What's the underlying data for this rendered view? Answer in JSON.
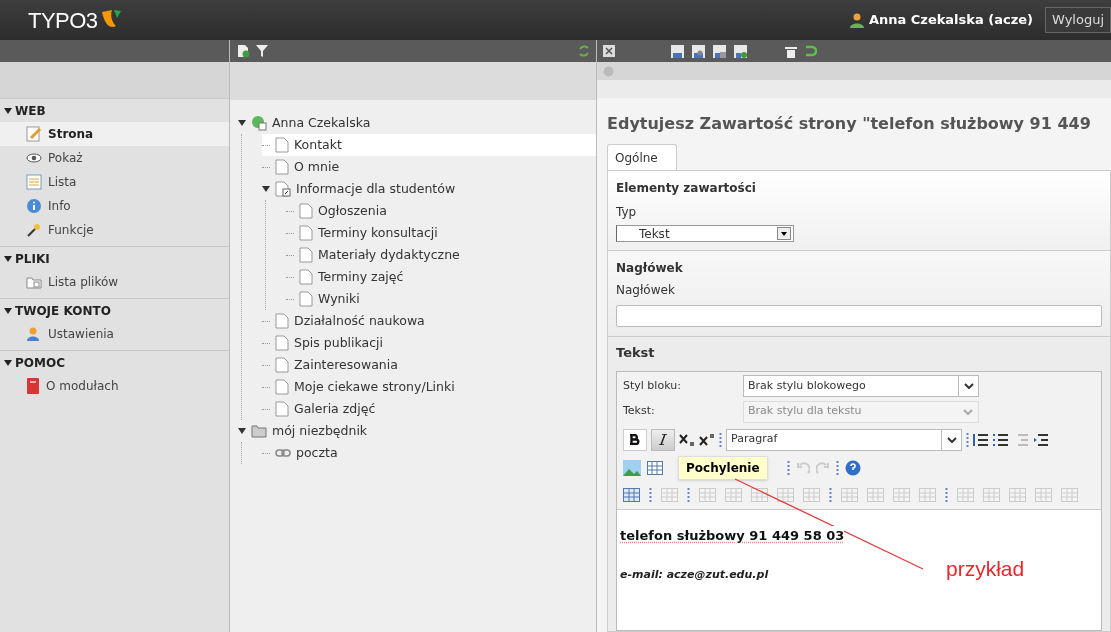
{
  "topbar": {
    "logo": "TYPO3",
    "user": "Anna Czekalska (acze)",
    "logout": "Wyloguj"
  },
  "modules": [
    {
      "title": "WEB",
      "expanded": true,
      "items": [
        {
          "label": "Strona",
          "kind": "page-edit",
          "selected": true
        },
        {
          "label": "Pokaż",
          "kind": "view",
          "selected": false
        },
        {
          "label": "Lista",
          "kind": "list",
          "selected": false
        },
        {
          "label": "Info",
          "kind": "info",
          "selected": false
        },
        {
          "label": "Funkcje",
          "kind": "functions",
          "selected": false
        }
      ]
    },
    {
      "title": "PLIKI",
      "expanded": true,
      "items": [
        {
          "label": "Lista plików",
          "kind": "filelist",
          "selected": false
        }
      ]
    },
    {
      "title": "TWOJE KONTO",
      "expanded": true,
      "items": [
        {
          "label": "Ustawienia",
          "kind": "settings",
          "selected": false
        }
      ]
    },
    {
      "title": "POMOC",
      "expanded": true,
      "items": [
        {
          "label": "O modułach",
          "kind": "about",
          "selected": false
        }
      ]
    }
  ],
  "tree": [
    {
      "label": "Anna Czekalska",
      "kind": "root",
      "expanded": true,
      "selected": false,
      "children": [
        {
          "label": "Kontakt",
          "kind": "page",
          "selected": true
        },
        {
          "label": "O mnie",
          "kind": "page",
          "selected": false
        },
        {
          "label": "Informacje dla studentów",
          "kind": "shortcut",
          "expanded": true,
          "selected": false,
          "children": [
            {
              "label": "Ogłoszenia",
              "kind": "page",
              "selected": false
            },
            {
              "label": "Terminy konsultacji",
              "kind": "page",
              "selected": false
            },
            {
              "label": "Materiały dydaktyczne",
              "kind": "page",
              "selected": false
            },
            {
              "label": "Terminy zajęć",
              "kind": "page",
              "selected": false
            },
            {
              "label": "Wyniki",
              "kind": "page",
              "selected": false
            }
          ]
        },
        {
          "label": "Działalność naukowa",
          "kind": "page",
          "selected": false
        },
        {
          "label": "Spis publikacji",
          "kind": "page",
          "selected": false
        },
        {
          "label": "Zainteresowania",
          "kind": "page",
          "selected": false
        },
        {
          "label": "Moje ciekawe strony/Linki",
          "kind": "page",
          "selected": false
        },
        {
          "label": "Galeria zdjęć",
          "kind": "page",
          "selected": false
        }
      ]
    },
    {
      "label": "mój niezbędnik",
      "kind": "folder",
      "expanded": true,
      "selected": false,
      "children": [
        {
          "label": "poczta",
          "kind": "link",
          "selected": false
        }
      ]
    }
  ],
  "editor": {
    "title": "Edytujesz Zawartość strony \"telefon służbowy 91 449",
    "tabs": [
      {
        "label": "Ogólne",
        "selected": true
      }
    ],
    "content_elements": {
      "heading": "Elementy zawartości",
      "type_label": "Typ",
      "type_value": "Tekst"
    },
    "header": {
      "heading": "Nagłówek",
      "label": "Nagłówek"
    },
    "text": {
      "heading": "Tekst",
      "block_style": {
        "label": "Styl bloku:",
        "value": "Brak stylu blokowego"
      },
      "text_style": {
        "label": "Tekst:",
        "value": "Brak stylu dla tekstu",
        "disabled": true
      },
      "format": {
        "value": "Paragraf"
      },
      "tooltip": "Pochylenie",
      "content": [
        {
          "kind": "heading",
          "text": "telefon służbowy 91 449 58 03"
        },
        {
          "kind": "email",
          "text": "e-mail: acze@zut.edu.pl"
        }
      ]
    }
  },
  "annotation": {
    "text": "przykład"
  }
}
